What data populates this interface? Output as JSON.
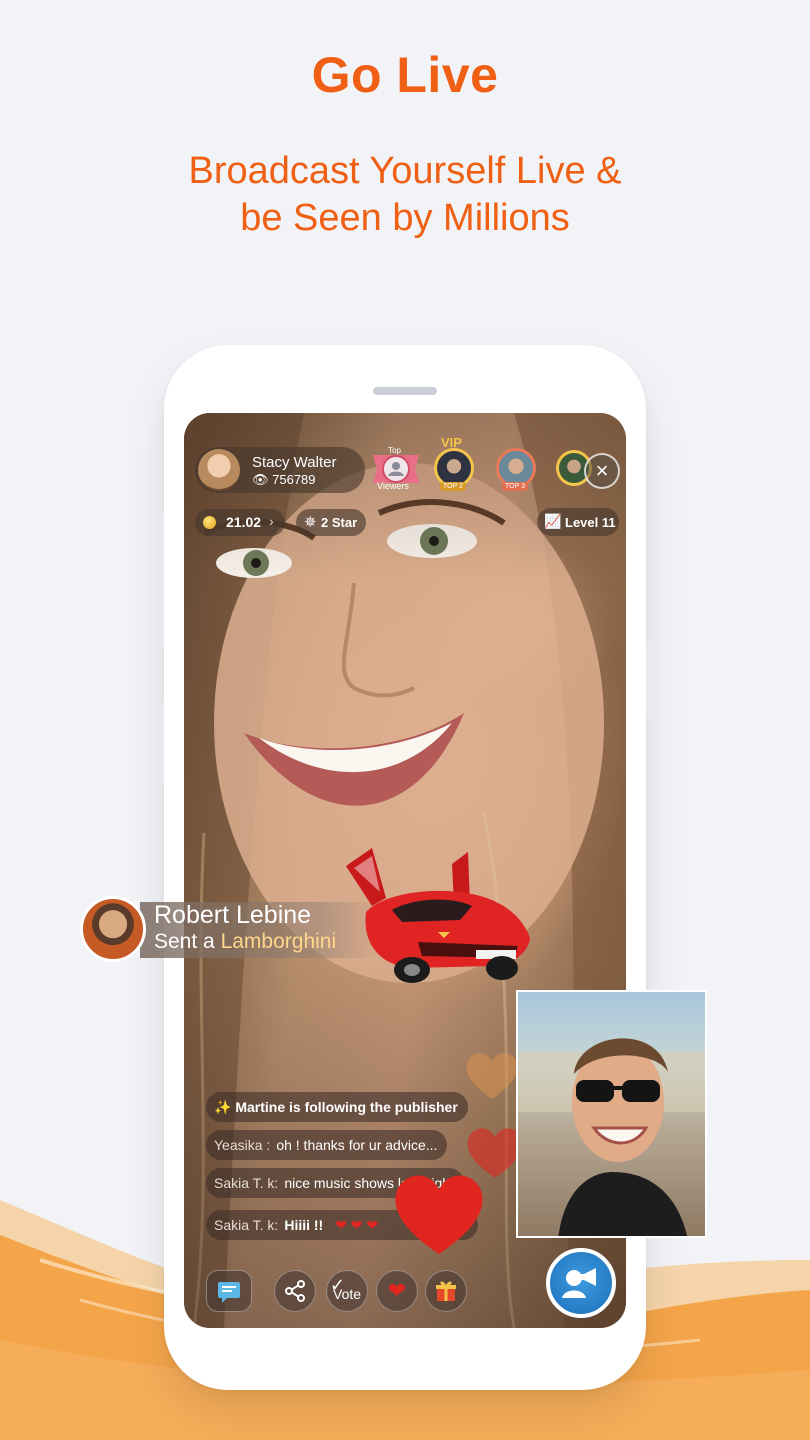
{
  "page": {
    "headline": "Go Live",
    "subline_1": "Broadcast Yourself Live &",
    "subline_2": "be Seen by Millions"
  },
  "colors": {
    "accent": "#ef5f14",
    "background": "#f2f3f7",
    "brush": "#f39c3a"
  },
  "stream": {
    "host_name": "Stacy Walter",
    "viewer_count": "756789",
    "top_viewers_badge_top": "Top",
    "top_viewers_badge_bottom": "Viewers",
    "vip_label": "VIP",
    "rank_2_label": "TOP 2",
    "rank_3_label": "TOP 3",
    "coins": "21.02",
    "stars": "2 Star",
    "level": "Level 11"
  },
  "gift": {
    "sender": "Robert Lebine",
    "action": "Sent a",
    "item": "Lamborghini"
  },
  "chat": [
    {
      "user": "Martine",
      "text": "is following the publisher"
    },
    {
      "user": "Yeasika :",
      "text": "oh ! thanks for ur advice..."
    },
    {
      "user": "Sakia T. k:",
      "text": "nice music shows last night"
    },
    {
      "user": "Sakia T. k:",
      "text": "Hiiii !!"
    }
  ],
  "toolbar": {
    "vote_label": "Vote"
  },
  "icons": [
    "eye-icon",
    "coin-icon",
    "star-icon",
    "level-chart-icon",
    "close-icon",
    "chat-icon",
    "share-icon",
    "vote-icon",
    "heart-icon",
    "gift-icon",
    "broadcast-icon"
  ]
}
